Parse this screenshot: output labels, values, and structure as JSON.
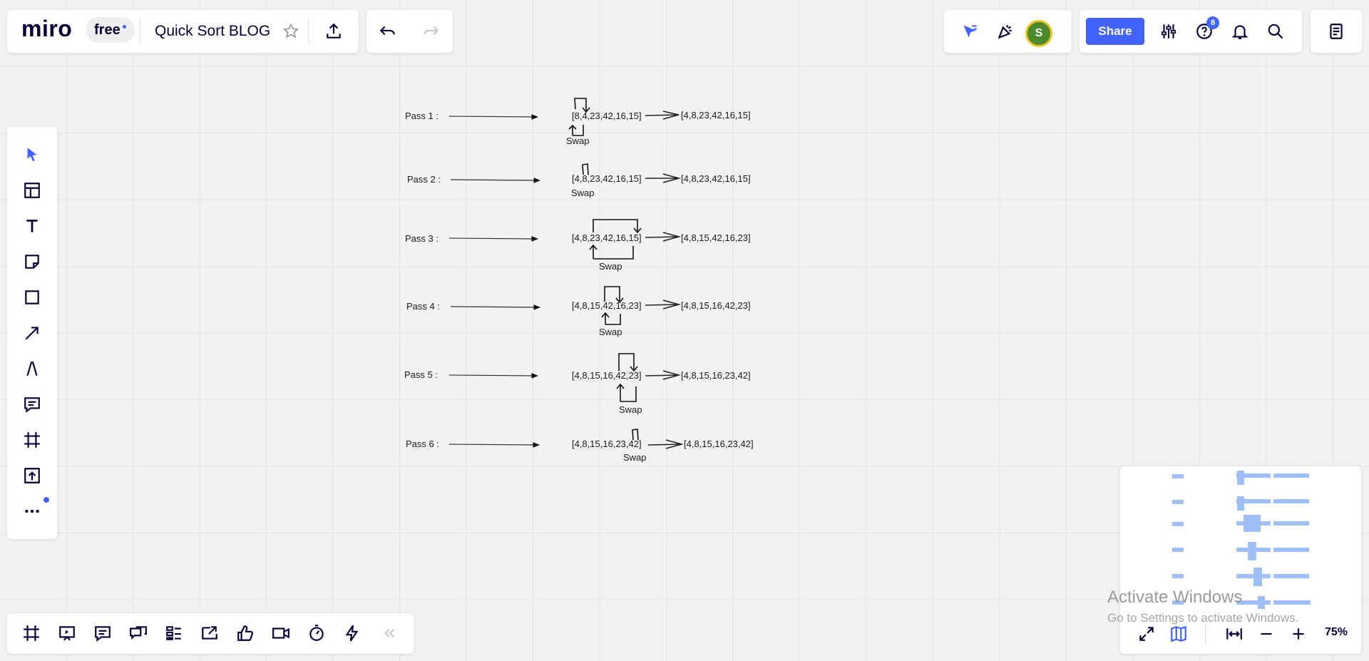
{
  "app": {
    "logo": "miro",
    "plan_badge": "free",
    "board_title": "Quick Sort BLOG",
    "share_label": "Share",
    "notification_count": "8",
    "avatar_initial": "S",
    "zoom_level": "75%"
  },
  "colors": {
    "accent": "#4262ff",
    "canvas_bg": "#f2f2f2",
    "minimap_bar": "#9fc0f6"
  },
  "toolbar_left": {
    "tools": [
      "select-cursor-icon",
      "templates-icon",
      "text-tool-icon",
      "sticky-note-icon",
      "shape-icon",
      "arrow-line-icon",
      "pen-icon",
      "comment-icon",
      "frame-icon",
      "upload-icon",
      "more-tools-icon"
    ]
  },
  "bottom_toolbar": {
    "tools": [
      "frames-icon",
      "presentation-icon",
      "comments-panel-icon",
      "chat-icon",
      "cards-icon",
      "share-screen-icon",
      "voting-icon",
      "video-call-icon",
      "timer-icon",
      "zap-icon",
      "collapse-icon"
    ]
  },
  "board": {
    "passes": [
      {
        "label": "Pass 1 :",
        "input": "[8,4,23,42,16,15]",
        "output": "[4,8,23,42,16,15]",
        "swap": "Swap"
      },
      {
        "label": "Pass 2 :",
        "input": "[4,8,23,42,16,15]",
        "output": "[4,8,23,42,16,15]",
        "swap": "Swap"
      },
      {
        "label": "Pass 3 :",
        "input": "[4,8,23,42,16,15]",
        "output": "[4,8,15,42,16,23]",
        "swap": "Swap"
      },
      {
        "label": "Pass 4 :",
        "input": "[4,8,15,42,16,23]",
        "output": "[4,8,15,16,42,23]",
        "swap": "Swap"
      },
      {
        "label": "Pass 5 :",
        "input": "[4,8,15,16,42,23]",
        "output": "[4,8,15,16,23,42]",
        "swap": "Swap"
      },
      {
        "label": "Pass 6 :",
        "input": "[4,8,15,16,23,42]",
        "output": "[4,8,15,16,23,42]",
        "swap": "Swap"
      }
    ]
  },
  "watermark": {
    "title": "Activate Windows",
    "subtitle": "Go to Settings to activate Windows."
  }
}
